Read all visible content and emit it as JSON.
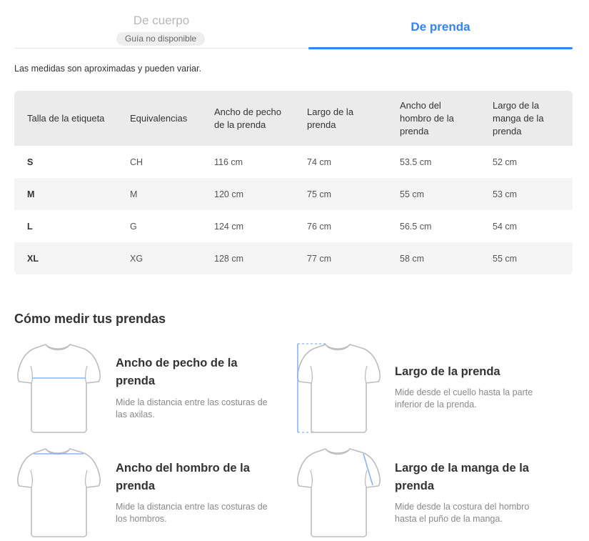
{
  "tabs": {
    "body": {
      "label": "De cuerpo",
      "badge": "Guía no disponible"
    },
    "garment": {
      "label": "De prenda"
    }
  },
  "note": "Las medidas son aproximadas y pueden variar.",
  "table": {
    "headers": [
      "Talla de la etiqueta",
      "Equivalencias",
      "Ancho de pecho de la prenda",
      "Largo de la prenda",
      "Ancho del hombro de la prenda",
      "Largo de la manga de la prenda"
    ],
    "rows": [
      [
        "S",
        "CH",
        "116 cm",
        "74 cm",
        "53.5 cm",
        "52 cm"
      ],
      [
        "M",
        "M",
        "120 cm",
        "75 cm",
        "55 cm",
        "53 cm"
      ],
      [
        "L",
        "G",
        "124 cm",
        "76 cm",
        "56.5 cm",
        "54 cm"
      ],
      [
        "XL",
        "XG",
        "128 cm",
        "77 cm",
        "58 cm",
        "55 cm"
      ]
    ]
  },
  "how_to": {
    "title": "Cómo medir tus prendas",
    "items": [
      {
        "title": "Ancho de pecho de la prenda",
        "desc": "Mide la distancia entre las costuras de las axilas."
      },
      {
        "title": "Largo de la prenda",
        "desc": "Mide desde el cuello hasta la parte inferior de la prenda."
      },
      {
        "title": "Ancho del hombro de la prenda",
        "desc": "Mide la distancia entre las costuras de los hombros."
      },
      {
        "title": "Largo de la manga de la prenda",
        "desc": "Mide desde la costura del hombro hasta el puño de la manga."
      }
    ]
  },
  "colors": {
    "accent": "#3483fa",
    "measure_line": "#8ab4f8",
    "shirt_outline": "#bdbdbd"
  },
  "icons": [
    "shirt-chest-width-icon",
    "shirt-length-icon",
    "shirt-shoulder-width-icon",
    "shirt-sleeve-length-icon"
  ]
}
